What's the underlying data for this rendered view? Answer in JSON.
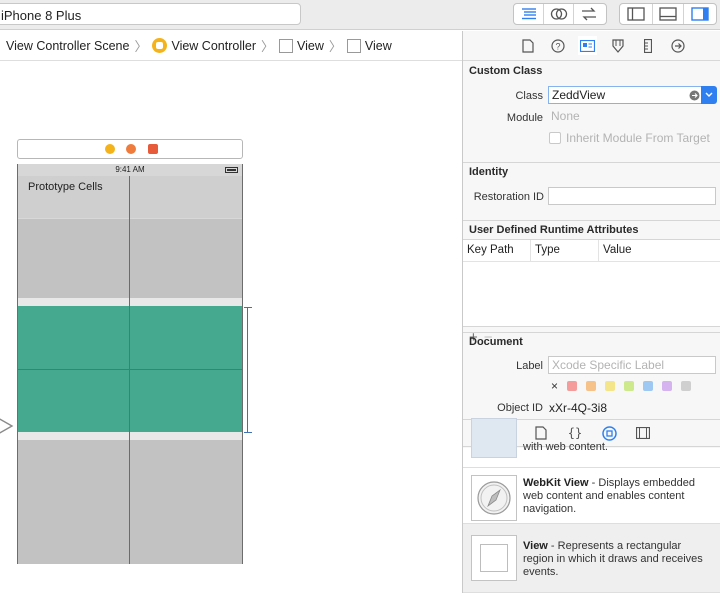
{
  "toolbar": {
    "scheme_label": "iPhone 8 Plus"
  },
  "breadcrumb": {
    "items": [
      "View Controller Scene",
      "View Controller",
      "View",
      "View"
    ]
  },
  "canvas": {
    "status_time": "9:41 AM",
    "prototype_label": "Prototype Cells"
  },
  "inspector": {
    "custom_class": {
      "title": "Custom Class",
      "class_label": "Class",
      "class_value": "ZeddView",
      "module_label": "Module",
      "module_placeholder": "None",
      "inherit_label": "Inherit Module From Target"
    },
    "identity": {
      "title": "Identity",
      "restoration_label": "Restoration ID",
      "restoration_value": ""
    },
    "runtime_attributes": {
      "title": "User Defined Runtime Attributes",
      "columns": [
        "Key Path",
        "Type",
        "Value"
      ],
      "add": "+",
      "remove": "−"
    },
    "document": {
      "title": "Document",
      "label_label": "Label",
      "label_placeholder": "Xcode Specific Label",
      "clear": "×",
      "swatch_colors": [
        "#f49c9c",
        "#f6c28a",
        "#f4e58a",
        "#cde98c",
        "#9ec8f2",
        "#d4b3ef",
        "#cfcfcf"
      ],
      "object_id_label": "Object ID",
      "object_id_value": "xXr-4Q-3i8"
    }
  },
  "library": {
    "partial_text": "with web content.",
    "items": [
      {
        "name": "WebKit View",
        "desc": " - Displays embedded web content and enables content navigation."
      },
      {
        "name": "View",
        "desc": " - Represents a rectangular region in which it draws and receives events."
      }
    ]
  },
  "colors": {
    "accent": "#2f7ff0",
    "teal_cell": "#45a990",
    "guide": "#3f72b8"
  }
}
